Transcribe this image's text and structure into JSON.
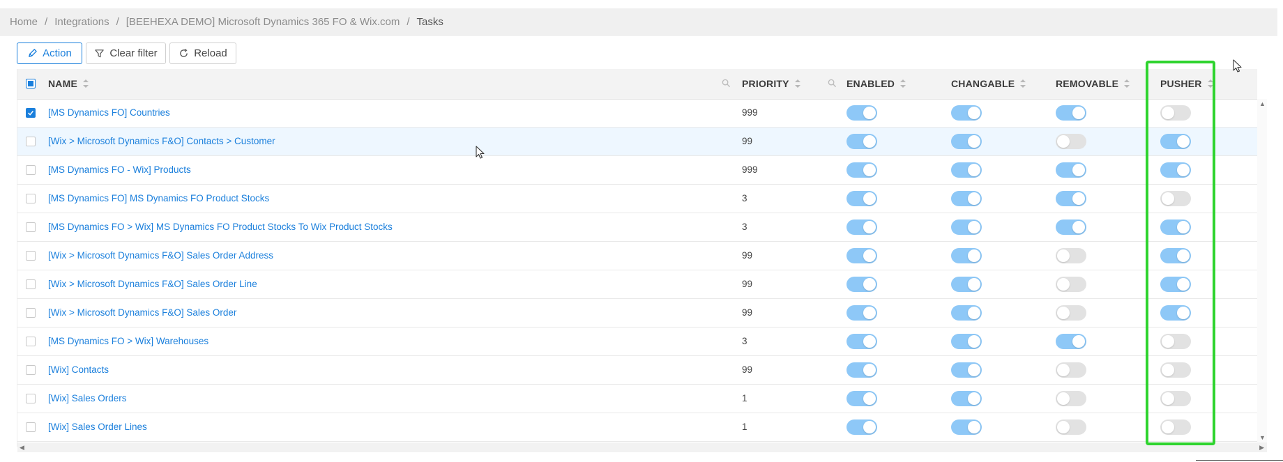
{
  "breadcrumb": [
    "Home",
    "Integrations",
    "[BEEHEXA DEMO] Microsoft Dynamics 365 FO & Wix.com",
    "Tasks"
  ],
  "toolbar": {
    "action_label": "Action",
    "clear_filter_label": "Clear filter",
    "reload_label": "Reload"
  },
  "columns": {
    "name": "NAME",
    "priority": "PRIORITY",
    "enabled": "ENABLED",
    "changable": "CHANGABLE",
    "removable": "REMOVABLE",
    "pusher": "PUSHER"
  },
  "rows": [
    {
      "name": "[MS Dynamics FO] Countries",
      "priority": "999",
      "checked": true,
      "enabled": true,
      "changable": true,
      "removable": true,
      "pusher": false
    },
    {
      "name": "[Wix > Microsoft Dynamics F&O] Contacts > Customer",
      "priority": "99",
      "checked": false,
      "enabled": true,
      "changable": true,
      "removable": false,
      "pusher": true
    },
    {
      "name": "[MS Dynamics FO - Wix] Products",
      "priority": "999",
      "checked": false,
      "enabled": true,
      "changable": true,
      "removable": true,
      "pusher": true
    },
    {
      "name": "[MS Dynamics FO] MS Dynamics FO Product Stocks",
      "priority": "3",
      "checked": false,
      "enabled": true,
      "changable": true,
      "removable": true,
      "pusher": false
    },
    {
      "name": "[MS Dynamics FO > Wix] MS Dynamics FO Product Stocks To Wix Product Stocks",
      "priority": "3",
      "checked": false,
      "enabled": true,
      "changable": true,
      "removable": true,
      "pusher": true
    },
    {
      "name": "[Wix > Microsoft Dynamics F&O] Sales Order Address",
      "priority": "99",
      "checked": false,
      "enabled": true,
      "changable": true,
      "removable": false,
      "pusher": true
    },
    {
      "name": "[Wix > Microsoft Dynamics F&O] Sales Order Line",
      "priority": "99",
      "checked": false,
      "enabled": true,
      "changable": true,
      "removable": false,
      "pusher": true
    },
    {
      "name": "[Wix > Microsoft Dynamics F&O] Sales Order",
      "priority": "99",
      "checked": false,
      "enabled": true,
      "changable": true,
      "removable": false,
      "pusher": true
    },
    {
      "name": "[MS Dynamics FO > Wix] Warehouses",
      "priority": "3",
      "checked": false,
      "enabled": true,
      "changable": true,
      "removable": true,
      "pusher": false
    },
    {
      "name": "[Wix] Contacts",
      "priority": "99",
      "checked": false,
      "enabled": true,
      "changable": true,
      "removable": false,
      "pusher": false
    },
    {
      "name": "[Wix] Sales Orders",
      "priority": "1",
      "checked": false,
      "enabled": true,
      "changable": true,
      "removable": false,
      "pusher": false
    },
    {
      "name": "[Wix] Sales Order Lines",
      "priority": "1",
      "checked": false,
      "enabled": true,
      "changable": true,
      "removable": false,
      "pusher": false
    }
  ],
  "colors": {
    "accent": "#1a7fdc",
    "toggle_on": "#8ec8f7",
    "toggle_off": "#e2e2e2",
    "highlight": "#2fd42f"
  }
}
